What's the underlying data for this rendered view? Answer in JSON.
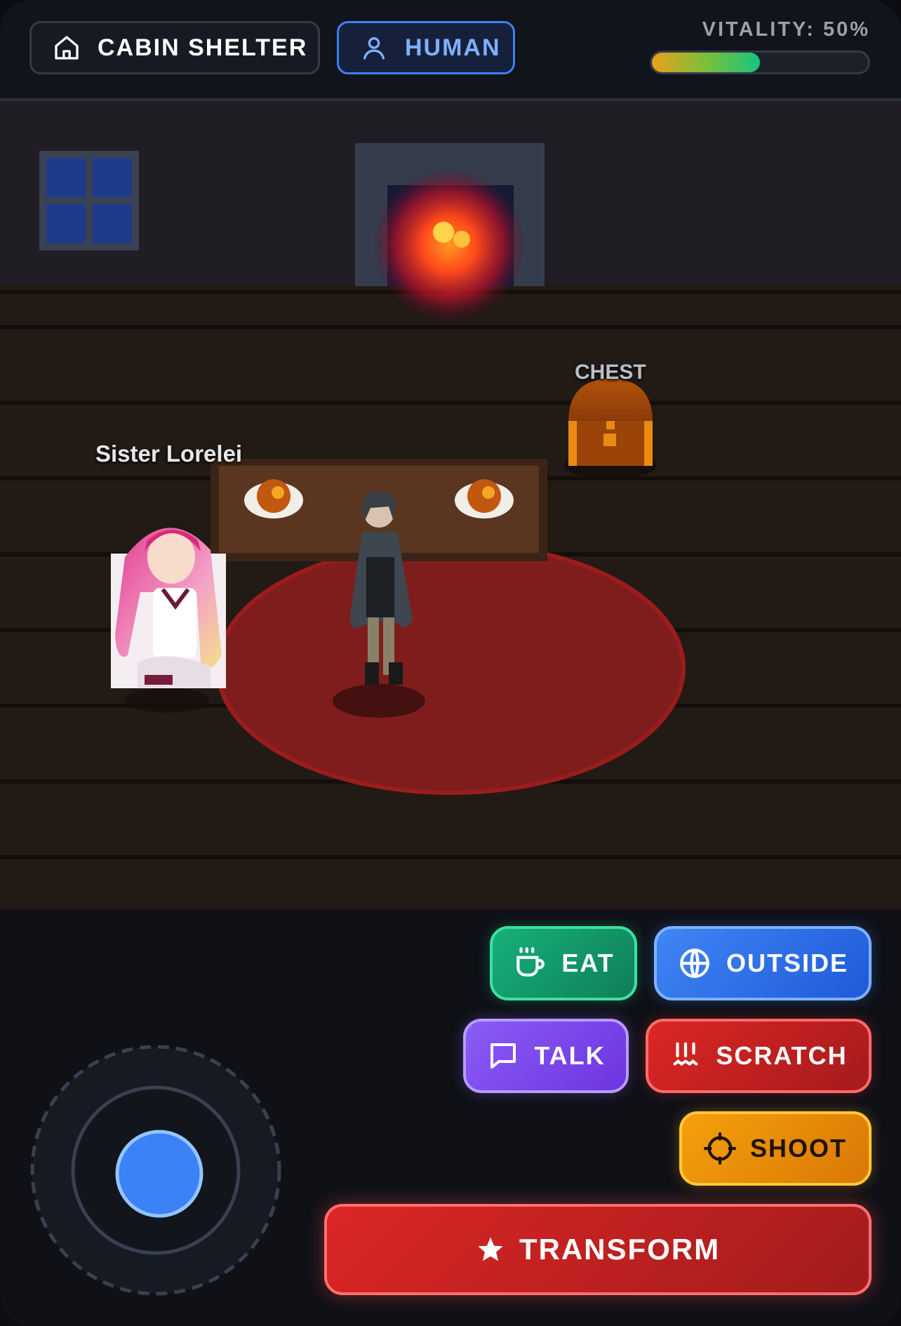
{
  "hud": {
    "location": {
      "label": "CABIN SHELTER",
      "icon": "home-icon"
    },
    "mode": {
      "label": "HUMAN",
      "icon": "user-icon"
    },
    "vitality": {
      "label": "VITALITY: 50%",
      "fraction": 0.5
    }
  },
  "scene": {
    "npc_name": "Sister Lorelei",
    "chest_label": "CHEST"
  },
  "actions": {
    "eat": {
      "label": "EAT",
      "icon": "cup-icon",
      "color": "#10b981"
    },
    "outside": {
      "label": "OUTSIDE",
      "icon": "globe-icon",
      "color": "#3b82f6"
    },
    "talk": {
      "label": "TALK",
      "icon": "chat-icon",
      "color": "#8b5cf6"
    },
    "scratch": {
      "label": "SCRATCH",
      "icon": "claw-icon",
      "color": "#dc2626"
    },
    "shoot": {
      "label": "SHOOT",
      "icon": "crosshair-icon",
      "color": "#f59e0b"
    },
    "transform": {
      "label": "TRANSFORM",
      "icon": "star-icon",
      "color": "#dc2626"
    }
  }
}
